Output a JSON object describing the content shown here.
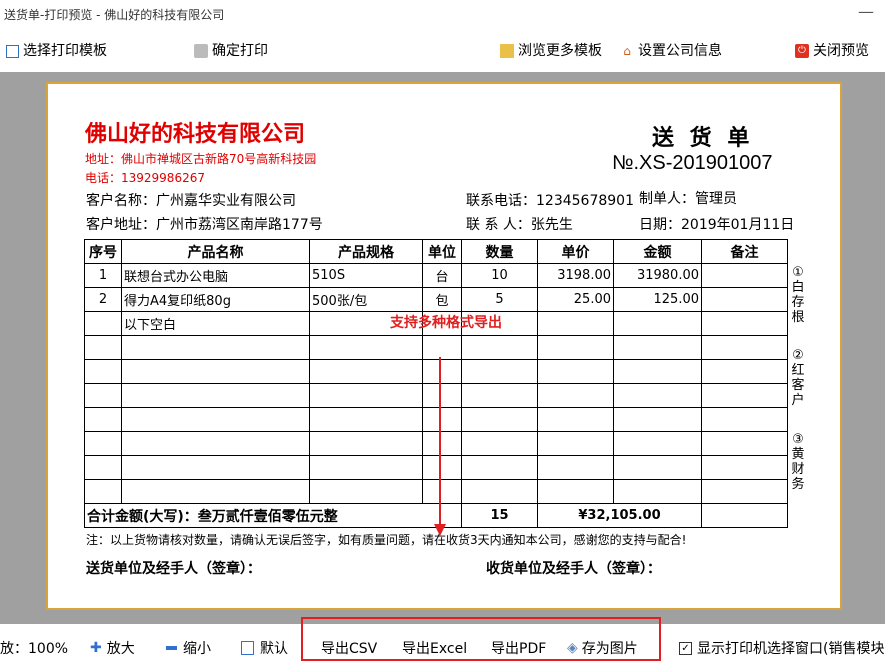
{
  "window": {
    "title": "送货单-打印预览 - 佛山好的科技有限公司",
    "minimize": "—"
  },
  "toolbar": {
    "select_template": "选择打印模板",
    "confirm_print": "确定打印",
    "browse_templates": "浏览更多模板",
    "company_settings": "设置公司信息",
    "close_preview": "关闭预览"
  },
  "doc": {
    "company": "佛山好的科技有限公司",
    "address": "地址：佛山市禅城区古新路70号高新科技园",
    "phone": "电话：13929986267",
    "title": "送 货 单",
    "number": "№.XS-201901007",
    "customer_name": "客户名称：广州嘉华实业有限公司",
    "contact_phone": "联系电话：12345678901",
    "maker": "制单人：管理员",
    "customer_address": "客户地址：广州市荔湾区南岸路177号",
    "contact_person": "联 系 人：张先生",
    "date": "日期：2019年01月11日",
    "headers": [
      "序号",
      "产品名称",
      "产品规格",
      "单位",
      "数量",
      "单价",
      "金额",
      "备注"
    ],
    "rows": [
      [
        "1",
        "联想台式办公电脑",
        "510S",
        "台",
        "10",
        "3198.00",
        "31980.00",
        ""
      ],
      [
        "2",
        "得力A4复印纸80g",
        "500张/包",
        "包",
        "5",
        "25.00",
        "125.00",
        ""
      ],
      [
        "",
        "以下空白",
        "",
        "",
        "",
        "",
        "",
        ""
      ]
    ],
    "total_label": "合计金额(大写)：叁万贰仟壹佰零伍元整",
    "total_qty": "15",
    "total_amount": "¥32,105.00",
    "note": "注：以上货物请核对数量，请确认无误后签字，如有质量问题，请在收货3天内通知本公司，感谢您的支持与配合!",
    "sender_sign": "送货单位及经手人（签章）：",
    "receiver_sign": "收货单位及经手人（签章）：",
    "side1": [
      "①",
      "白",
      "存",
      "根"
    ],
    "side2": [
      "②",
      "红",
      "客",
      "户"
    ],
    "side3": [
      "③",
      "黄",
      "财",
      "务"
    ]
  },
  "annotation": {
    "text": "支持多种格式导出",
    "color": "#e02020"
  },
  "statusbar": {
    "zoom": "放：100%",
    "zoom_in": "放大",
    "zoom_out": "缩小",
    "default": "默认",
    "export_csv": "导出CSV",
    "export_excel": "导出Excel",
    "export_pdf": "导出PDF",
    "save_image": "存为图片",
    "show_printer": "显示打印机选择窗口(销售模块"
  },
  "colors": {
    "accent_red": "#e00000",
    "paper_border": "#d9a53a",
    "canvas_bg": "#a0a0a0"
  }
}
